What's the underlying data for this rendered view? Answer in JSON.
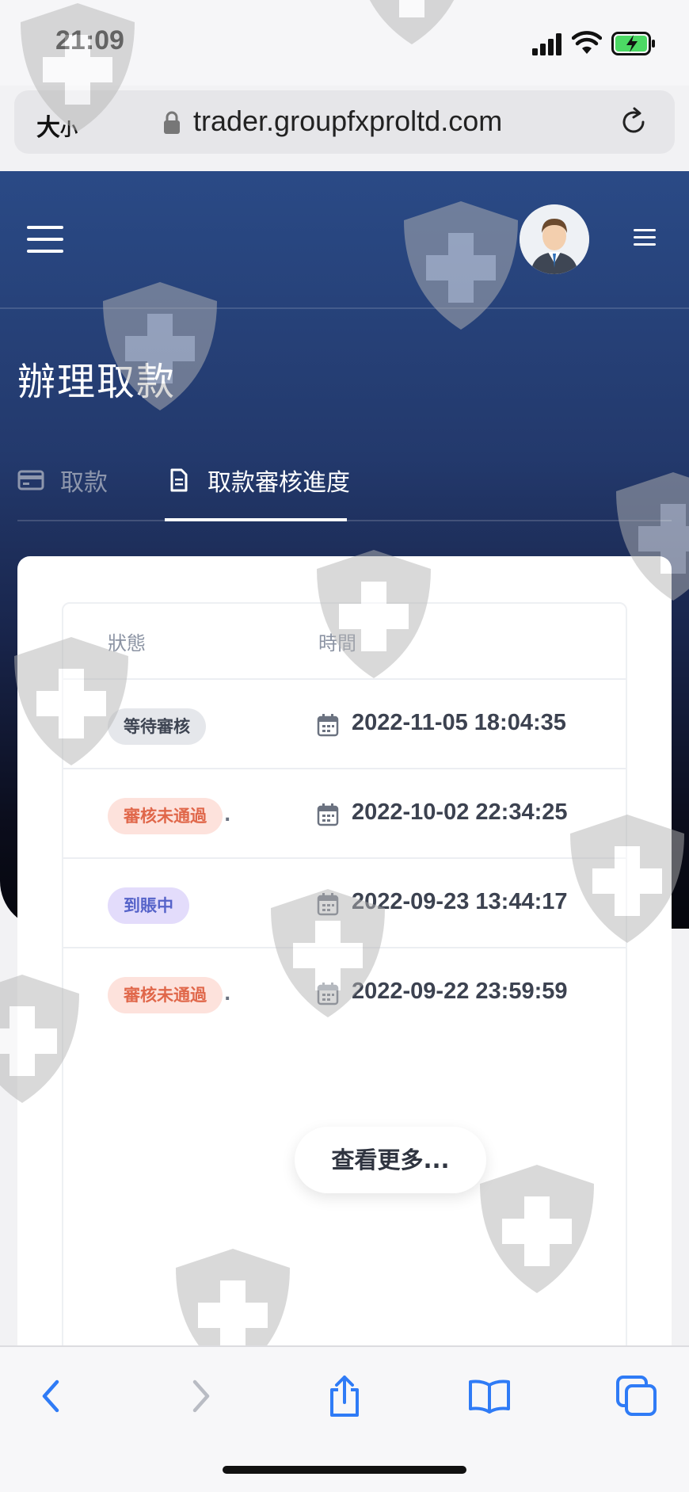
{
  "status_bar": {
    "time": "21:09"
  },
  "browser": {
    "text_size_big": "大",
    "text_size_small": "小",
    "url": "trader.groupfxproltd.com"
  },
  "page": {
    "title": "辦理取款"
  },
  "tabs": [
    {
      "label": "取款",
      "icon": "credit-card-icon",
      "active": false
    },
    {
      "label": "取款審核進度",
      "icon": "document-icon",
      "active": true
    }
  ],
  "table": {
    "headers": {
      "status": "狀態",
      "time": "時間"
    },
    "rows": [
      {
        "status": "等待審核",
        "status_color": "#e5e7eb",
        "status_text_color": "#3d4452",
        "trailing": "",
        "datetime": "2022-11-05 18:04:35"
      },
      {
        "status": "審核未通過",
        "status_color": "#fde2dc",
        "status_text_color": "#e0674a",
        "trailing": ".",
        "datetime": "2022-10-02 22:34:25"
      },
      {
        "status": "到賬中",
        "status_color": "#e3dcfb",
        "status_text_color": "#5663c9",
        "trailing": "",
        "datetime": "2022-09-23 13:44:17"
      },
      {
        "status": "審核未通過",
        "status_color": "#fde2dc",
        "status_text_color": "#e0674a",
        "trailing": ".",
        "datetime": "2022-09-22 23:59:59"
      }
    ]
  },
  "more_button": {
    "label": "查看更多..."
  },
  "toolbar": {
    "items": [
      "back-icon",
      "forward-icon",
      "share-icon",
      "bookmarks-icon",
      "tabs-icon"
    ],
    "accent": "#2f7bf6"
  }
}
